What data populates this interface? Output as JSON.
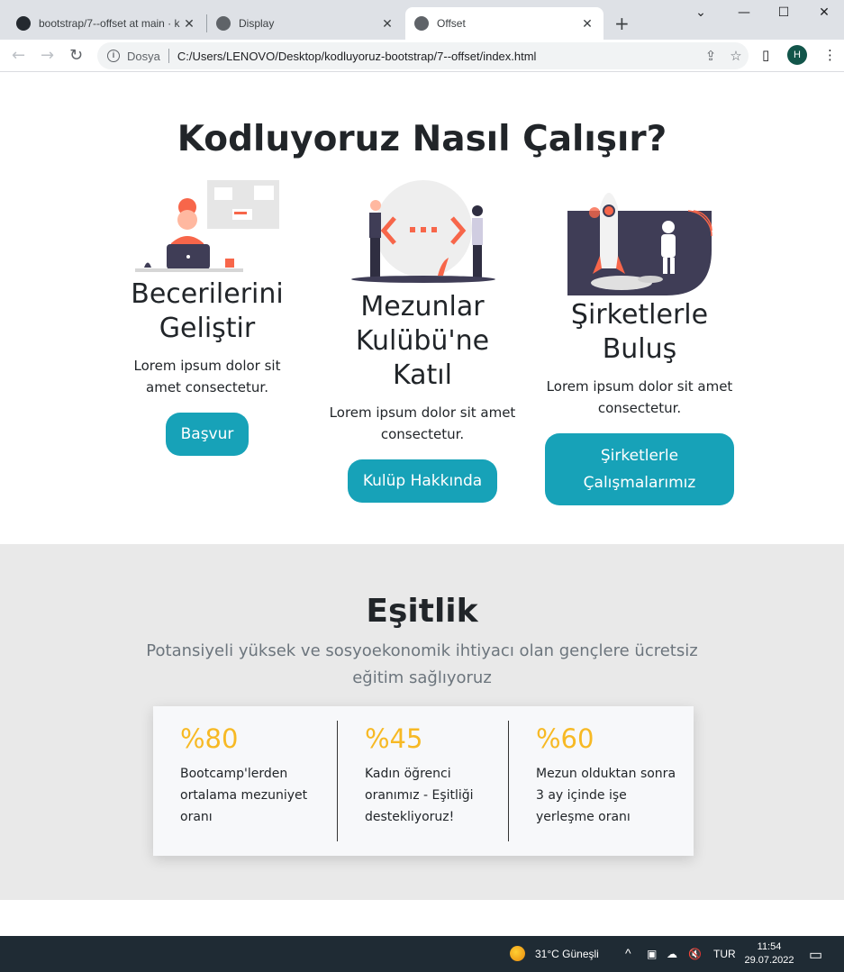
{
  "browser": {
    "tabs": [
      {
        "title": "bootstrap/7--offset at main · k",
        "active": false
      },
      {
        "title": "Display",
        "active": false
      },
      {
        "title": "Offset",
        "active": true
      }
    ],
    "new_tab": "+",
    "window_controls": {
      "dropdown": "⌄",
      "minimize": "—",
      "maximize": "☐",
      "close": "✕"
    },
    "scheme_label": "Dosya",
    "url": "C:/Users/LENOVO/Desktop/kodluyoruz-bootstrap/7--offset/index.html",
    "profile_initial": "H"
  },
  "page": {
    "heading": "Kodluyoruz Nasıl Çalışır?",
    "cards": [
      {
        "title": "Becerilerini Geliştir",
        "text": "Lorem ipsum dolor sit amet consectetur.",
        "button": "Başvur"
      },
      {
        "title": "Mezunlar Kulübü'ne Katıl",
        "text": "Lorem ipsum dolor sit amet consectetur.",
        "button": "Kulüp Hakkında"
      },
      {
        "title": "Şirketlerle Buluş",
        "text": "Lorem ipsum dolor sit amet consectetur.",
        "button": "Şirketlerle Çalışmalarımız"
      }
    ],
    "equality": {
      "title": "Eşitlik",
      "subtitle": "Potansiyeli yüksek ve sosyoekonomik ihtiyacı olan gençlere ücretsiz eğitim sağlıyoruz",
      "stats": [
        {
          "value": "%80",
          "text": "Bootcamp'lerden ortalama mezuniyet oranı"
        },
        {
          "value": "%45",
          "text": "Kadın öğrenci oranımız - Eşitliği destekliyoruz!"
        },
        {
          "value": "%60",
          "text": "Mezun olduktan sonra 3 ay içinde işe yerleşme oranı"
        }
      ]
    }
  },
  "colors": {
    "accent": "#17a2b8",
    "stat": "#f7b924",
    "illustration_orange": "#f7664a",
    "illustration_dark": "#3f3d56"
  },
  "taskbar": {
    "weather": "31°C  Güneşli",
    "language": "TUR",
    "time": "11:54",
    "date": "29.07.2022"
  }
}
